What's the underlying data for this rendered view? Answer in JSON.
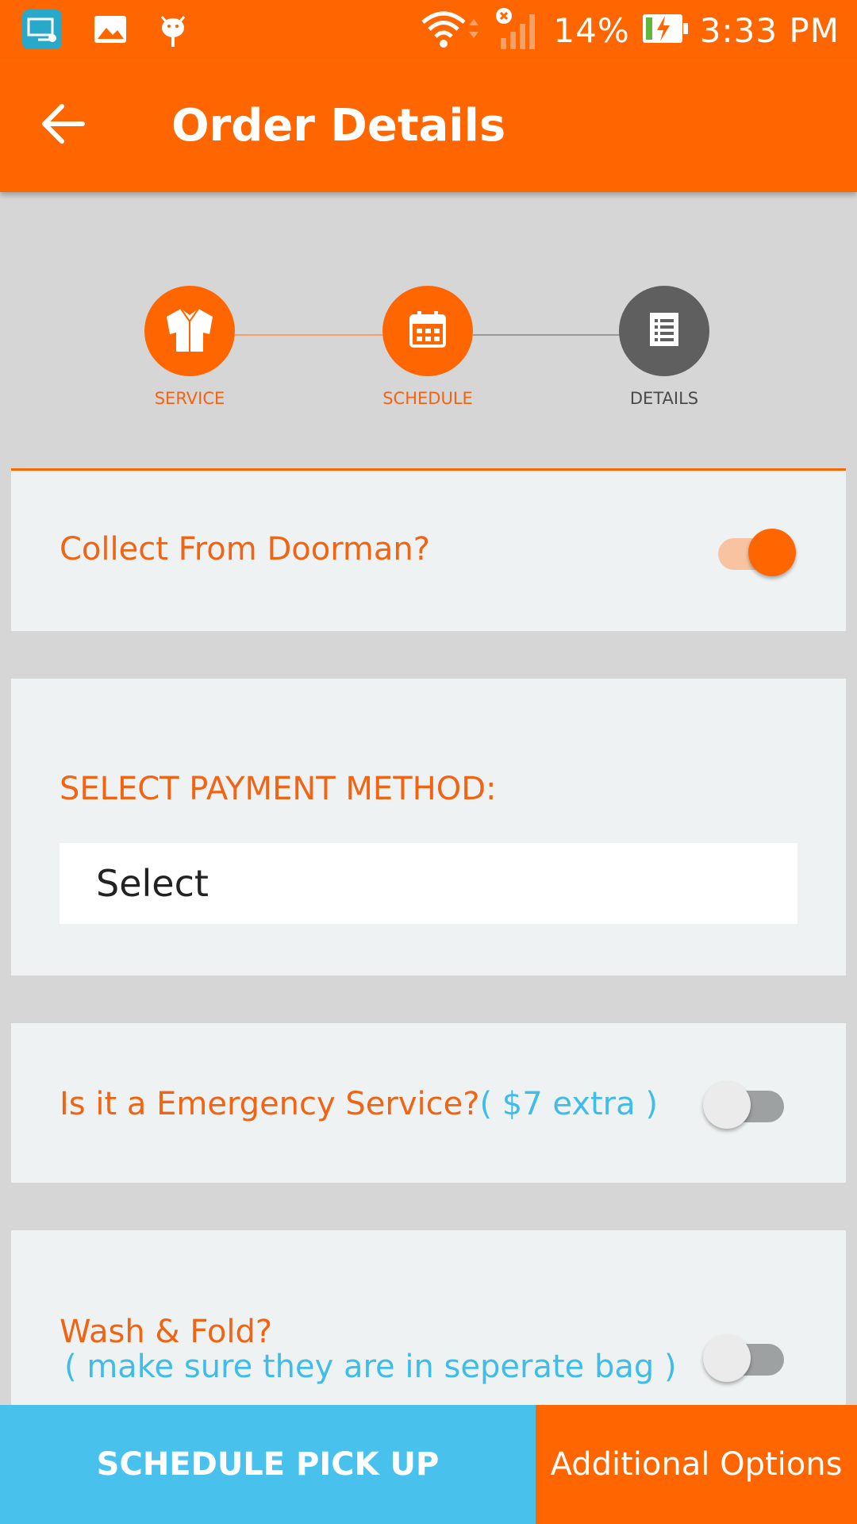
{
  "status_bar": {
    "battery": "14%",
    "time": "3:33 PM",
    "icons_left": [
      "screen-cast-icon",
      "image-icon",
      "android-icon"
    ],
    "icons_right": [
      "wifi-icon",
      "signal-icon",
      "battery-charging-icon"
    ]
  },
  "header": {
    "title": "Order Details",
    "back_icon": "arrow-left-icon"
  },
  "stepper": {
    "steps": [
      {
        "label": "SERVICE",
        "icon": "shirt-icon",
        "state": "complete"
      },
      {
        "label": "SCHEDULE",
        "icon": "calendar-icon",
        "state": "complete"
      },
      {
        "label": "DETAILS",
        "icon": "list-icon",
        "state": "current"
      }
    ]
  },
  "collect_card": {
    "label": "Collect From Doorman?",
    "toggle_on": true
  },
  "payment_card": {
    "label": "SELECT PAYMENT METHOD:",
    "select_value": "Select"
  },
  "emergency_card": {
    "label": "Is it a Emergency Service?",
    "note": "( $7 extra )",
    "toggle_on": false
  },
  "wash_card": {
    "label": "Wash & Fold?",
    "note": "( make sure they are in seperate bag )",
    "toggle_on": false
  },
  "bottom": {
    "schedule_label": "SCHEDULE PICK UP",
    "options_label": "Additional Options"
  },
  "colors": {
    "primary": "#ff6600",
    "accent_blue": "#48c2ed",
    "inactive_gray": "#5f5f5f",
    "card_bg": "#eff2f3",
    "page_bg": "#d6d6d6"
  }
}
